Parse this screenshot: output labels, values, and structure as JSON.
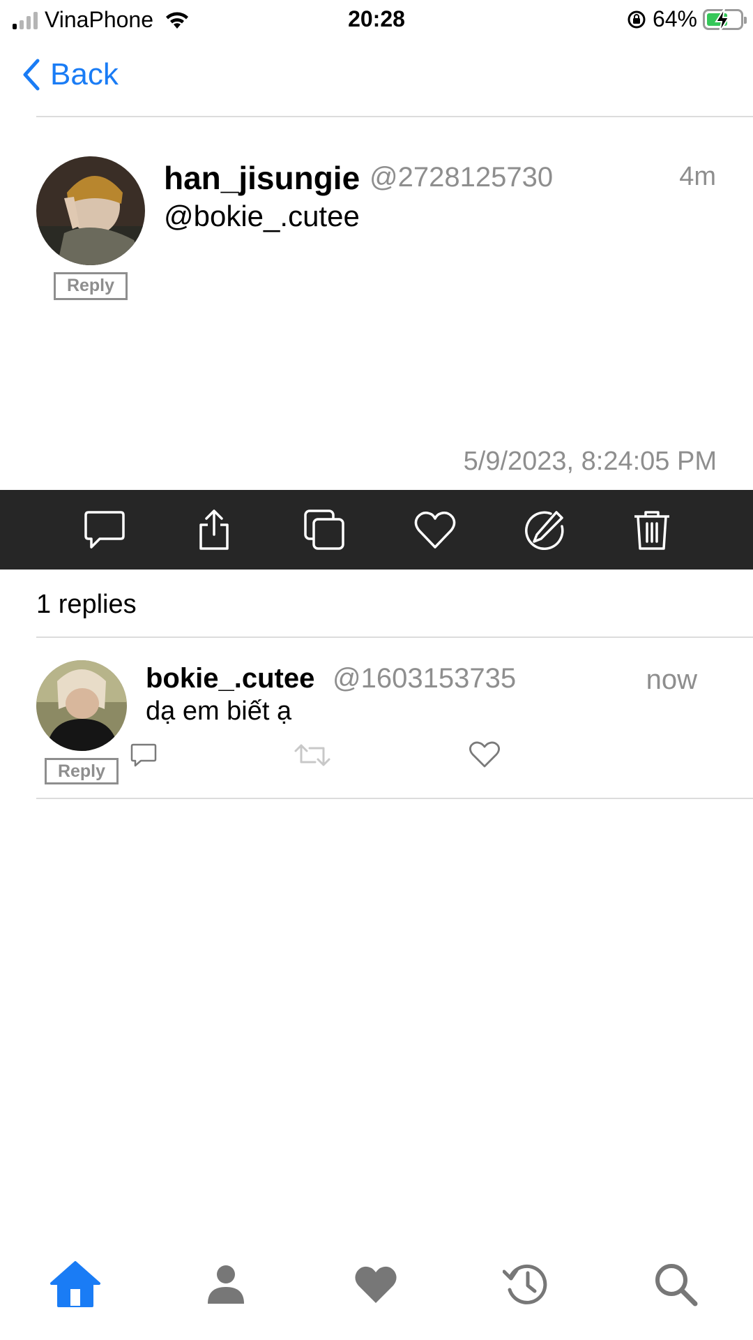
{
  "status_bar": {
    "carrier": "VinaPhone",
    "time": "20:28",
    "battery_percent": "64%",
    "signal_bars_filled": 1,
    "signal_bars_total": 4,
    "battery_level": 0.64,
    "battery_color": "#35c759"
  },
  "nav": {
    "back_label": "Back",
    "accent": "#1a7cf5"
  },
  "tweet": {
    "username": "han_jisungie",
    "handle": "@2728125730",
    "relative_time": "4m",
    "text": "@bokie_.cutee",
    "reply_badge": "Reply",
    "timestamp": "5/9/2023, 8:24:05 PM"
  },
  "action_bar": {
    "icons": [
      "comment-icon",
      "share-icon",
      "copy-icon",
      "heart-icon",
      "edit-icon",
      "trash-icon"
    ]
  },
  "replies": {
    "count_label": "1 replies",
    "items": [
      {
        "username": "bokie_.cutee",
        "handle": "@1603153735",
        "relative_time": "now",
        "text": "dạ em biết ạ",
        "reply_badge": "Reply"
      }
    ]
  },
  "tab_bar": {
    "tabs": [
      "home-icon",
      "profile-icon",
      "heart-icon",
      "history-icon",
      "search-icon"
    ],
    "active": "home-icon"
  }
}
